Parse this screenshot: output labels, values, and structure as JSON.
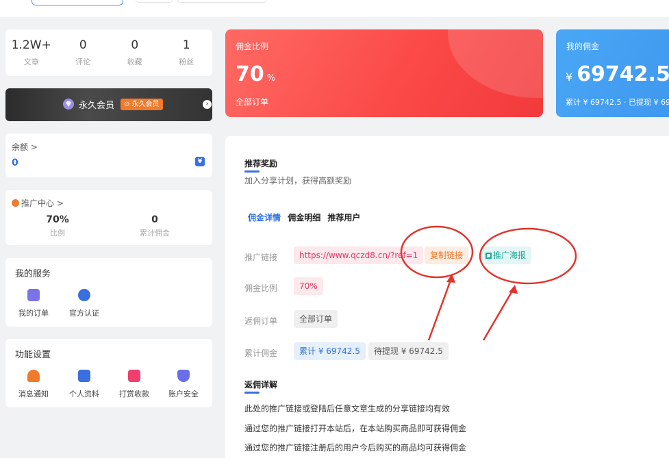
{
  "stats": [
    {
      "value": "1.2W+",
      "label": "文章"
    },
    {
      "value": "0",
      "label": "评论"
    },
    {
      "value": "0",
      "label": "收藏"
    },
    {
      "value": "1",
      "label": "粉丝"
    }
  ],
  "vip": {
    "label": "永久会员",
    "badge": "⊙ 永久会员"
  },
  "balance": {
    "title": "余额 >",
    "value": "0"
  },
  "promo_center": {
    "title": "推广中心 >",
    "ratio_value": "70%",
    "ratio_label": "比例",
    "total_value": "0",
    "total_label": "累计佣金"
  },
  "services": {
    "title": "我的服务",
    "items": [
      {
        "label": "我的订单",
        "icon": "order-icon",
        "color": "#7b74e8"
      },
      {
        "label": "官方认证",
        "icon": "verified-icon",
        "color": "#3a6fe0"
      }
    ]
  },
  "settings": {
    "title": "功能设置",
    "items": [
      {
        "label": "消息通知",
        "icon": "bell-icon",
        "color": "#f07b2d"
      },
      {
        "label": "个人资料",
        "icon": "profile-icon",
        "color": "#3a6fe0"
      },
      {
        "label": "打赏收款",
        "icon": "gift-icon",
        "color": "#ef3f6f"
      },
      {
        "label": "账户安全",
        "icon": "shield-icon",
        "color": "#6a6fe8"
      }
    ]
  },
  "commission_card": {
    "title": "佣金比例",
    "value": "70",
    "unit": "%",
    "sub": "全部订单"
  },
  "my_commission_card": {
    "title": "我的佣金",
    "currency": "¥",
    "value": "69742.5",
    "sub": "累计 ¥ 69742.5  ·  已提现 ¥ 69"
  },
  "main": {
    "section1_title": "推荐奖励",
    "section1_desc": "加入分享计划，获得高额奖励",
    "tabs": [
      "佣金详情",
      "佣金明细",
      "推荐用户"
    ],
    "link_label": "推广链接",
    "link_value": "https://www.qczd8.cn/?ref=1",
    "copy_label": "复制链接",
    "poster_label": "推广海报",
    "ratio_label": "佣金比例",
    "ratio_value": "70%",
    "order_label": "返佣订单",
    "order_value": "全部订单",
    "total_label": "累计佣金",
    "total_value": "累计 ¥ 69742.5",
    "pending_value": "待提现 ¥ 69742.5",
    "section2_title": "返佣详解",
    "details": [
      "此处的推广链接或登陆后任意文章生成的分享链接均有效",
      "通过您的推广链接打开本站后，在本站购买商品即可获得佣金",
      "通过您的推广链接注册后的用户今后购买的商品均可获得佣金"
    ]
  },
  "colors": {
    "accent": "#2f6fe0",
    "red_card": "#fb4a48",
    "blue_card": "#3e97ef",
    "annotation": "#e4332b"
  }
}
